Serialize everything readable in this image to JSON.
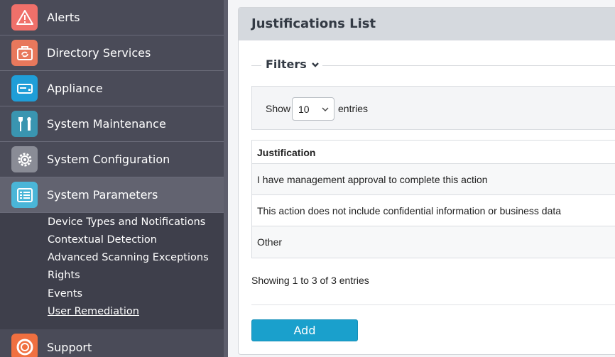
{
  "sidebar": {
    "items": [
      {
        "label": "Alerts",
        "icon": "alert-triangle-icon",
        "color": "#f0706a"
      },
      {
        "label": "Directory Services",
        "icon": "directory-sync-icon",
        "color": "#e8785c"
      },
      {
        "label": "Appliance",
        "icon": "appliance-icon",
        "color": "#1f9ed8"
      },
      {
        "label": "System Maintenance",
        "icon": "tools-icon",
        "color": "#3a95b0"
      },
      {
        "label": "System Configuration",
        "icon": "gear-icon",
        "color": "#8a8c96"
      },
      {
        "label": "System Parameters",
        "icon": "list-icon",
        "color": "#4ab6d8"
      },
      {
        "label": "Support",
        "icon": "lifebuoy-icon",
        "color": "#f07040"
      }
    ],
    "subitems": [
      "Device Types and Notifications",
      "Contextual Detection",
      "Advanced Scanning Exceptions",
      "Rights",
      "Events",
      "User Remediation"
    ]
  },
  "panel": {
    "title": "Justifications List",
    "filters_label": "Filters",
    "show_label": "Show",
    "entries_value": "10",
    "entries_label": "entries",
    "table": {
      "header": "Justification",
      "rows": [
        "I have management approval to complete this action",
        "This action does not include confidential information or business data",
        "Other"
      ]
    },
    "showing_info": "Showing 1 to 3 of 3 entries",
    "add_label": "Add"
  },
  "colors": {
    "sidebar_bg": "#4a4b58",
    "subnav_bg": "#3e3f4b",
    "accent": "#1aa0cc",
    "header_bg": "#d5d9de"
  }
}
